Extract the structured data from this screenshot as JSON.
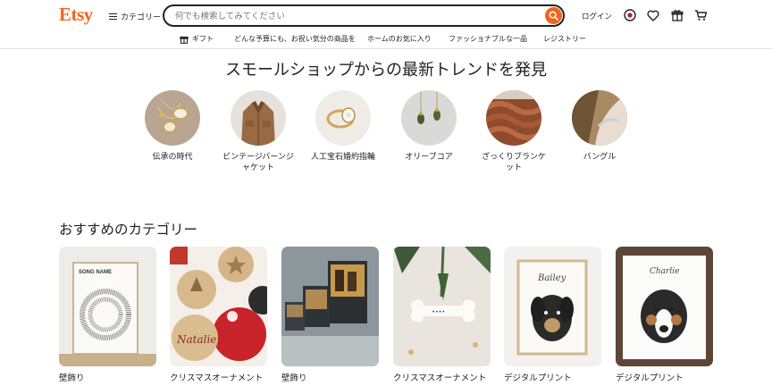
{
  "header": {
    "logo": "Etsy",
    "categories_label": "カテゴリー",
    "search_placeholder": "何でも検索してみてください",
    "login_label": "ログイン"
  },
  "subnav": {
    "items": [
      "ギフト",
      "どんな予算にも、お祝い気分の商品を",
      "ホームのお気に入り",
      "ファッショナブルな一品",
      "レジストリー"
    ]
  },
  "trends": {
    "title": "スモールショップからの最新トレンドを発見",
    "items": [
      {
        "label": "伝承の時代"
      },
      {
        "label": "ビンテージバーンジャケット"
      },
      {
        "label": "人工宝石婚約指輪"
      },
      {
        "label": "オリーブコア"
      },
      {
        "label": "ざっくりブランケット"
      },
      {
        "label": "バングル"
      }
    ]
  },
  "recommended": {
    "title": "おすすめのカテゴリー",
    "items": [
      {
        "label": "壁飾り",
        "img_text": "SONG NAME"
      },
      {
        "label": "クリスマスオーナメント",
        "img_text": "Natalie"
      },
      {
        "label": "壁飾り"
      },
      {
        "label": "クリスマスオーナメント"
      },
      {
        "label": "デジタルプリント",
        "img_text": "Bailey"
      },
      {
        "label": "デジタルプリント",
        "img_text": "Charlie"
      }
    ]
  },
  "colors": {
    "accent": "#f1641e",
    "text": "#222222"
  }
}
